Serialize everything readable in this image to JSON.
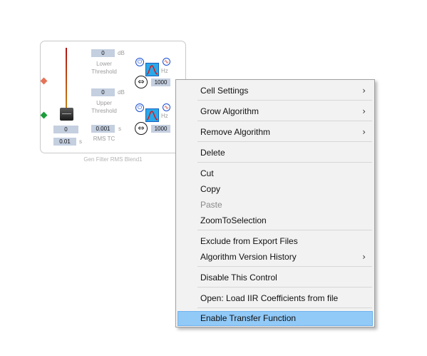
{
  "block": {
    "caption": "Gen Filter RMS Blend1",
    "fader_value": "0",
    "fader_step": "0.01",
    "fader_step_unit": "s",
    "lower_threshold": {
      "value": "0",
      "unit": "dB",
      "label_line1": "Lower",
      "label_line2": "Threshold"
    },
    "upper_threshold": {
      "value": "0",
      "unit": "dB",
      "label_line1": "Upper",
      "label_line2": "Threshold"
    },
    "rms_tc": {
      "value": "0.001",
      "unit": "s",
      "label": "RMS TC"
    },
    "filter1": {
      "freq": "1000",
      "unit": "Hz"
    },
    "filter2": {
      "freq": "1000",
      "unit": "Hz"
    },
    "icons": {
      "power": "⏻",
      "phase": "⇔",
      "wave": "∿"
    },
    "colors": {
      "pin_input": "#1a9e3a",
      "pin_output": "#e57357",
      "filter_fill": "#29a9e9"
    }
  },
  "menu": {
    "items": [
      {
        "label": "Cell Settings",
        "submenu": true,
        "arrow": "›"
      },
      {
        "label": "Grow Algorithm",
        "submenu": true,
        "arrow": "›"
      },
      {
        "label": "Remove Algorithm",
        "submenu": true,
        "arrow": "›"
      },
      {
        "label": "Delete"
      },
      {
        "label": "Cut"
      },
      {
        "label": "Copy"
      },
      {
        "label": "Paste",
        "disabled": true
      },
      {
        "label": "ZoomToSelection"
      },
      {
        "label": "Exclude from Export Files"
      },
      {
        "label": "Algorithm Version History",
        "submenu": true,
        "arrow": "›"
      },
      {
        "label": "Disable This Control"
      },
      {
        "label": "Open: Load IIR Coefficients from file"
      },
      {
        "label": "Enable Transfer Function",
        "highlighted": true
      }
    ],
    "highlight_color": "#91c9f7"
  }
}
